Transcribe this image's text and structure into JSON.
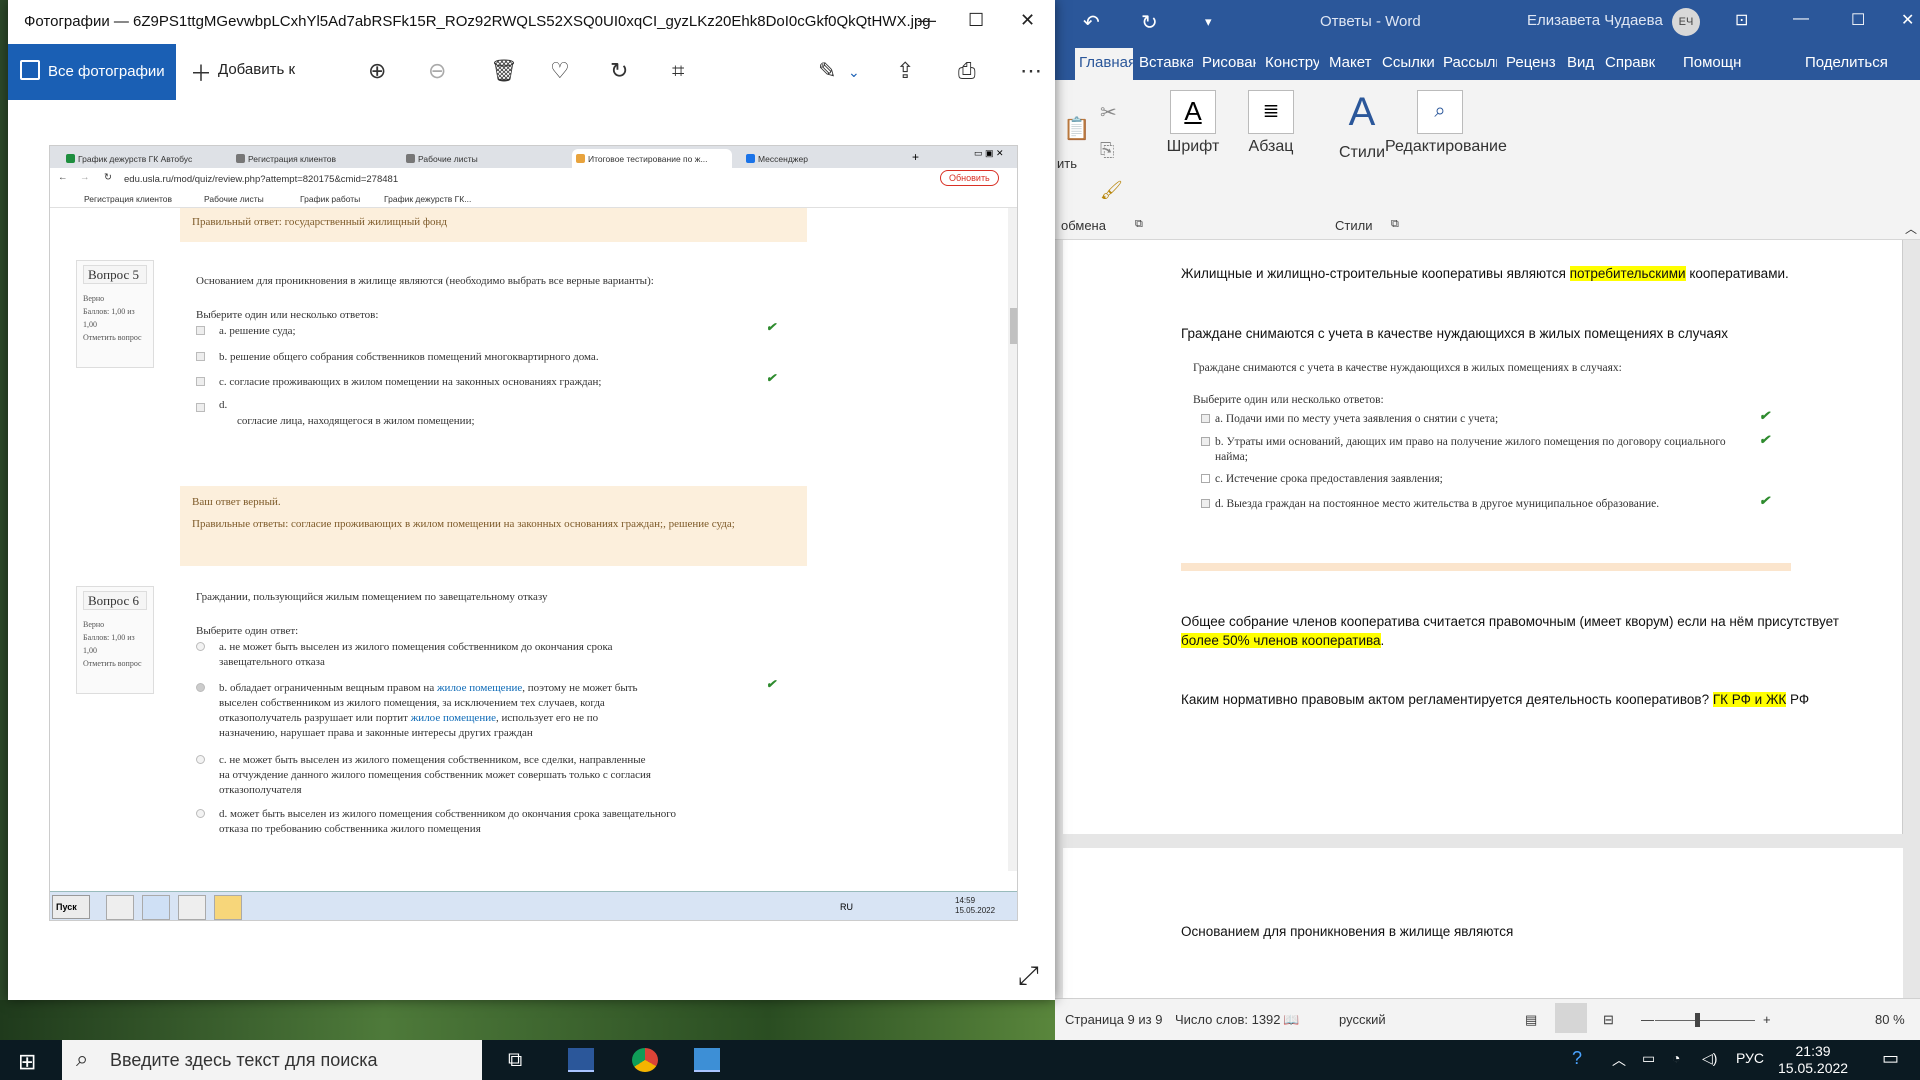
{
  "photos": {
    "title": "Фотографии — 6Z9PS1ttgMGevwbpLCxhYl5Ad7abRSFk15R_ROz92RWQLS52XSQ0UI0xqCI_gyzLKz20Ehk8DoI0cGkf0QkQtHWX.jpg",
    "all_photos": "Все фотографии",
    "add": "Добавить к"
  },
  "browser": {
    "tabs": [
      "График дежурств ГК Автобус",
      "Регистрация клиентов",
      "Рабочие листы",
      "Итоговое тестирование по ж...",
      "Мессенджер"
    ],
    "url": "edu.usla.ru/mod/quiz/review.php?attempt=820175&cmid=278481",
    "update": "Обновить",
    "bookmarks": [
      "Регистрация клиентов",
      "Рабочие листы",
      "График работы",
      "График дежурств ГК..."
    ]
  },
  "quiz": {
    "prev_correct": "Правильный ответ: государственный жилищный фонд",
    "q5": {
      "num": "Вопрос 5",
      "status": "Верно",
      "score": "Баллов: 1,00 из 1,00",
      "flag": "Отметить вопрос",
      "text": "Основанием для проникновения в жилище являются (необходимо выбрать все верные варианты):",
      "prompt": "Выберите один или несколько ответов:",
      "opts": [
        "a.   решение суда;",
        "b.   решение общего собрания собственников помещений многоквартирного дома.",
        "c.   согласие проживающих в жилом помещении на законных основаниях граждан;",
        "d.",
        "согласие лица, находящегося в жилом помещении;"
      ],
      "fb1": "Ваш ответ верный.",
      "fb2": "Правильные ответы: согласие проживающих в жилом помещении на законных основаниях граждан;, решение суда;"
    },
    "q6": {
      "num": "Вопрос 6",
      "status": "Верно",
      "score": "Баллов: 1,00 из 1,00",
      "flag": "Отметить вопрос",
      "text": "Граждании, пользующийся жилым помещением по завещательному отказу",
      "prompt": "Выберите один ответ:",
      "a": "a.   не может быть выселен из жилого помещения собственником до окончания срока завещательного отказа",
      "b1": "b.   обладает ограниченным вещным правом на ",
      "b_link1": "жилое помещение",
      "b2": ",  поэтому не может быть выселен собственником из жилого помещения, за исключением тех случаев, когда отказополучатель разрушает или портит ",
      "b_link2": "жилое помещение",
      "b3": ", использует его не по назначению, нарушает права и законные интересы других граждан",
      "c": "c.   не может быть выселен из жилого помещения собственником, все сделки, направленные на отчуждение данного жилого помещения собственник может совершать только с согласия отказополучателя",
      "d": "d.   может быть выселен из жилого помещения собственником до окончания срока завещательного отказа по требованию собственника жилого помещения"
    }
  },
  "xp": {
    "start": "Пуск",
    "lang": "RU",
    "time": "14:59",
    "date": "15.05.2022"
  },
  "word": {
    "doc_name": "Ответы  -  Word",
    "user": "Елизавета Чудаева",
    "initials": "ЕЧ",
    "tabs": [
      "Главная",
      "Вставка",
      "Рисован",
      "Констру",
      "Макет",
      "Ссылки",
      "Рассылк",
      "Реценз",
      "Вид",
      "Справк",
      "Помощн",
      "Поделиться"
    ],
    "ribbon": {
      "font": "Шрифт",
      "paragraph": "Абзац",
      "styles": "Стили",
      "editing": "Редактирование",
      "clipboard": "обмена",
      "styles_group": "Стили",
      "paste_frag": "ить"
    },
    "p1a": "Жилищные и жилищно-строительные кооперативы являются ",
    "p1b": "потребительскими",
    "p1c": " кооперативами.",
    "p2": "Граждане снимаются с учета в качестве нуждающихся в жилых помещениях в случаях",
    "embed": {
      "q": "Граждане снимаются с учета в качестве нуждающихся в жилых помещениях в случаях:",
      "prompt": "Выберите один или несколько ответов:",
      "a": "a.    Подачи ими по месту учета заявления о снятии с учета;",
      "b": "b.    Утраты ими оснований, дающих им право на получение жилого помещения по договору социального найма;",
      "c": "c.    Истечение срока предоставления заявления;",
      "d": "d.    Выезда граждан на постоянное место жительства в другое муниципальное образование."
    },
    "p3a": "Общее собрание членов кооператива считается правомочным (имеет кворум) если на нём присутствует ",
    "p3b": "более 50% членов кооператива",
    "p3c": ".",
    "p4a": "Каким нормативно правовым актом регламентируется деятельность кооперативов? ",
    "p4b": "ГК РФ и ЖК",
    "p4c": " РФ",
    "p5": "Основанием для проникновения в жилище являются",
    "status": {
      "page": "Страница 9 из 9",
      "words": "Число слов: 1392",
      "lang": "русский",
      "zoom": "80 %"
    }
  },
  "taskbar": {
    "search": "Введите здесь текст для поиска",
    "lang": "РУС",
    "time": "21:39",
    "date": "15.05.2022"
  }
}
